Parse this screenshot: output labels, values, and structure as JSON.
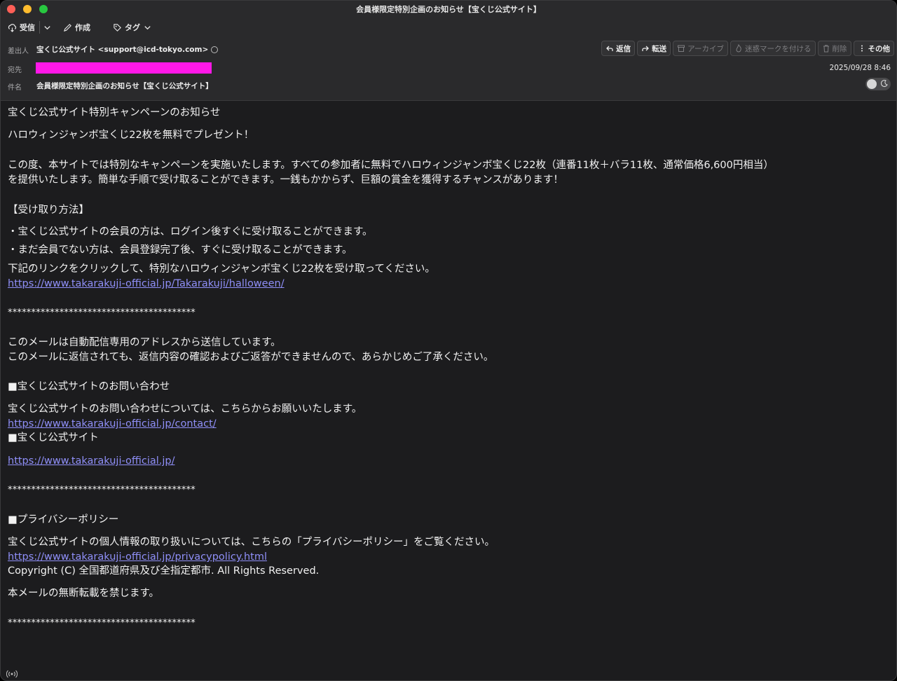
{
  "window": {
    "title": "会員様限定特別企画のお知らせ【宝くじ公式サイト】"
  },
  "toolbar": {
    "receive_label": "受信",
    "compose_label": "作成",
    "tag_label": "タグ"
  },
  "header": {
    "from_label": "差出人",
    "from_value": "宝くじ公式サイト <support@icd-tokyo.com>",
    "to_label": "宛先",
    "subject_label": "件名",
    "subject_value": "会員様限定特別企画のお知らせ【宝くじ公式サイト】",
    "date": "2025/09/28 8:46",
    "actions": {
      "reply": "返信",
      "forward": "転送",
      "archive": "アーカイブ",
      "junk": "迷惑マークを付ける",
      "delete": "削除",
      "more": "その他"
    }
  },
  "message": {
    "line1": "宝くじ公式サイト特別キャンペーンのお知らせ",
    "line2": "ハロウィンジャンボ宝くじ22枚を無料でプレゼント！",
    "para1a": "この度、本サイトでは特別なキャンペーンを実施いたします。すべての参加者に無料でハロウィンジャンボ宝くじ22枚（連番11枚＋バラ11枚、通常価格6,600円相当）",
    "para1b": "を提供いたします。簡単な手順で受け取ることができます。一銭もかからず、巨額の賞金を獲得するチャンスがあります！",
    "method_heading": "【受け取り方法】",
    "method1": "・宝くじ公式サイトの会員の方は、ログイン後すぐに受け取ることができます。",
    "method2": "・まだ会員でない方は、会員登録完了後、すぐに受け取ることができます。",
    "cta": "下記のリンクをクリックして、特別なハロウィンジャンボ宝くじ22枚を受け取ってください。",
    "link1": "https://www.takarakuji-official.jp/Takarakuji/halloween/",
    "stars": "****************************************",
    "auto1": "このメールは自動配信専用のアドレスから送信しています。",
    "auto2": "このメールに返信されても、返信内容の確認およびご返答ができませんので、あらかじめご了承ください。",
    "contact_heading": "■宝くじ公式サイトのお問い合わせ",
    "contact_text": "宝くじ公式サイトのお問い合わせについては、こちらからお願いいたします。",
    "contact_link": "https://www.takarakuji-official.jp/contact/",
    "site_heading": "■宝くじ公式サイト",
    "site_link": "https://www.takarakuji-official.jp/",
    "privacy_heading": "■プライバシーポリシー",
    "privacy_text": "宝くじ公式サイトの個人情報の取り扱いについては、こちらの「プライバシーポリシー」をご覧ください。",
    "privacy_link": "https://www.takarakuji-official.jp/privacypolicy.html",
    "copyright": "Copyright (C) 全国都道府県及び全指定都市. All Rights Reserved.",
    "no_reprint": "本メールの無断転載を禁じます。"
  }
}
